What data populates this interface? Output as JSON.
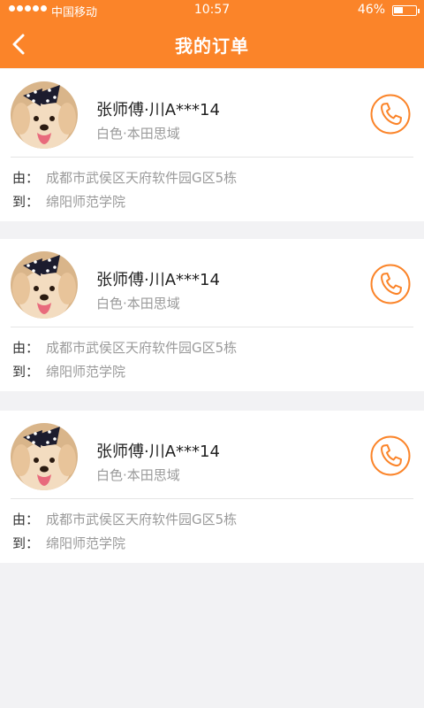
{
  "status_bar": {
    "carrier": "中国移动",
    "time": "10:57",
    "battery_percent_text": "46%",
    "battery_level": 0.46
  },
  "header": {
    "title": "我的订单",
    "back_icon": "back-chevron-icon"
  },
  "colors": {
    "accent": "#fb8429",
    "background": "#f2f2f4"
  },
  "orders": [
    {
      "driver": "张师傅·川A***14",
      "car": "白色·本田思域",
      "from_label": "由：",
      "from": "成都市武侯区天府软件园G区5栋",
      "to_label": "到：",
      "to": "绵阳师范学院"
    },
    {
      "driver": "张师傅·川A***14",
      "car": "白色·本田思域",
      "from_label": "由：",
      "from": "成都市武侯区天府软件园G区5栋",
      "to_label": "到：",
      "to": "绵阳师范学院"
    },
    {
      "driver": "张师傅·川A***14",
      "car": "白色·本田思域",
      "from_label": "由：",
      "from": "成都市武侯区天府软件园G区5栋",
      "to_label": "到：",
      "to": "绵阳师范学院"
    }
  ]
}
